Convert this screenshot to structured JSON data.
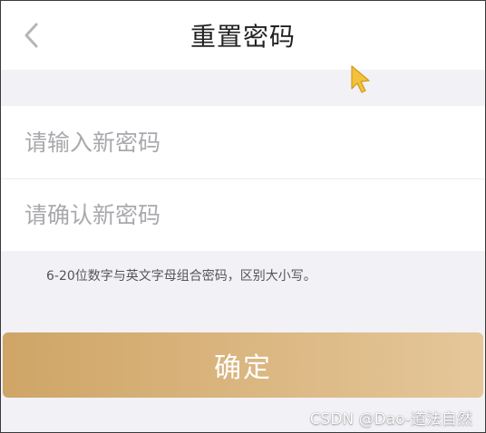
{
  "header": {
    "title": "重置密码",
    "back_icon": "chevron-left-icon"
  },
  "form": {
    "new_password_placeholder": "请输入新密码",
    "confirm_password_placeholder": "请确认新密码"
  },
  "hint": "6-20位数字与英文字母组合密码，区别大小写。",
  "confirm_button": {
    "label": "确定",
    "gradient_start": "#cfa567",
    "gradient_end": "#e5c79a"
  },
  "watermark": "CSDN @Dao-道法自然",
  "colors": {
    "page_background": "#f2f2f6",
    "cursor_fill": "#f2c23a"
  }
}
